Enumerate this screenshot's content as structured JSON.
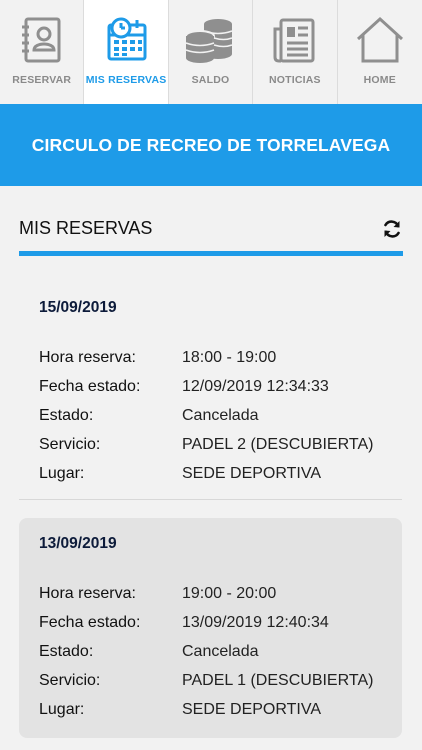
{
  "tabs": [
    {
      "label": "RESERVAR",
      "icon": "address-book-icon",
      "active": false
    },
    {
      "label": "MIS RESERVAS",
      "icon": "calendar-icon",
      "active": true
    },
    {
      "label": "SALDO",
      "icon": "coins-icon",
      "active": false
    },
    {
      "label": "NOTICIAS",
      "icon": "newspaper-icon",
      "active": false
    },
    {
      "label": "HOME",
      "icon": "home-icon",
      "active": false
    }
  ],
  "banner": {
    "title": "CIRCULO DE RECREO DE TORRELAVEGA"
  },
  "section": {
    "title": "MIS RESERVAS",
    "refresh_icon": "refresh-icon"
  },
  "labels": {
    "hora": "Hora reserva:",
    "fecha_estado": "Fecha estado:",
    "estado": "Estado:",
    "servicio": "Servicio:",
    "lugar": "Lugar:"
  },
  "reservations": [
    {
      "date": "15/09/2019",
      "hora": "18:00 - 19:00",
      "fecha_estado": "12/09/2019 12:34:33",
      "estado": "Cancelada",
      "servicio": "PADEL 2 (DESCUBIERTA)",
      "lugar": "SEDE DEPORTIVA"
    },
    {
      "date": "13/09/2019",
      "hora": "19:00 - 20:00",
      "fecha_estado": "13/09/2019 12:40:34",
      "estado": "Cancelada",
      "servicio": "PADEL 1 (DESCUBIERTA)",
      "lugar": "SEDE DEPORTIVA"
    }
  ],
  "colors": {
    "accent": "#1e9be8",
    "inactive": "#8a8a8a",
    "date_text": "#0d1b3a"
  }
}
